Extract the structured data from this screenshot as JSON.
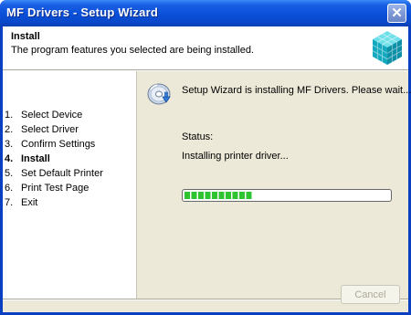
{
  "window": {
    "title": "MF Drivers - Setup Wizard",
    "close_symbol": "✕"
  },
  "header": {
    "title": "Install",
    "subtitle": "The program features you selected are being installed.",
    "logo_icon": "canon-cube-icon"
  },
  "steps": [
    {
      "num": "1.",
      "label": "Select Device",
      "current": false
    },
    {
      "num": "2.",
      "label": "Select Driver",
      "current": false
    },
    {
      "num": "3.",
      "label": "Confirm Settings",
      "current": false
    },
    {
      "num": "4.",
      "label": "Install",
      "current": true
    },
    {
      "num": "5.",
      "label": "Set Default Printer",
      "current": false
    },
    {
      "num": "6.",
      "label": "Print Test Page",
      "current": false
    },
    {
      "num": "7.",
      "label": "Exit",
      "current": false
    }
  ],
  "content": {
    "icon": "install-disc-icon",
    "message": "Setup Wizard is installing MF Drivers. Please wait...",
    "status_label": "Status:",
    "status_text": "Installing printer driver...",
    "progress_fraction": 0.36,
    "progress_color": "#2ec431"
  },
  "footer": {
    "cancel_label": "Cancel",
    "cancel_enabled": false
  },
  "colors": {
    "title_bar": "#0a4fd8",
    "dialog_face": "#ece9d8"
  }
}
